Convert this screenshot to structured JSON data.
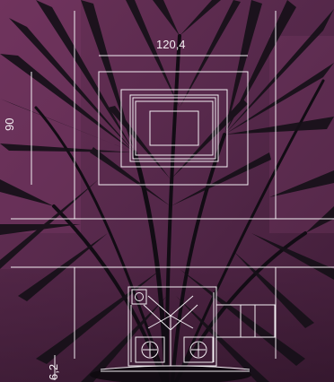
{
  "dimensions": {
    "width": "120,4",
    "height": "90",
    "depth": "6,2"
  },
  "colors": {
    "background_wall": "#5b2a4c",
    "wall_shade": "#3b1832",
    "leaf_dark": "#161018",
    "line_white": "#f2eef2"
  },
  "views": {
    "front_view": "front-elevation",
    "section_view": "section-detail"
  }
}
